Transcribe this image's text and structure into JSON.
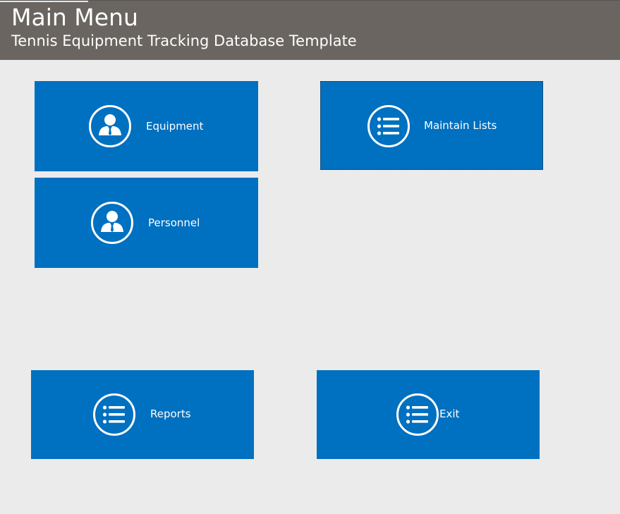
{
  "header": {
    "title": "Main Menu",
    "subtitle": "Tennis Equipment Tracking Database Template"
  },
  "colors": {
    "header_bg": "#6a6560",
    "page_bg": "#ebebeb",
    "tile_bg": "#0070c0",
    "tile_text": "#ffffff"
  },
  "tiles": {
    "equipment": {
      "label": "Equipment",
      "icon": "person-icon"
    },
    "personnel": {
      "label": "Personnel",
      "icon": "person-icon"
    },
    "maintain_lists": {
      "label": "Maintain Lists",
      "icon": "list-icon"
    },
    "reports": {
      "label": "Reports",
      "icon": "list-icon"
    },
    "exit": {
      "label": "Exit",
      "icon": "list-icon"
    }
  }
}
